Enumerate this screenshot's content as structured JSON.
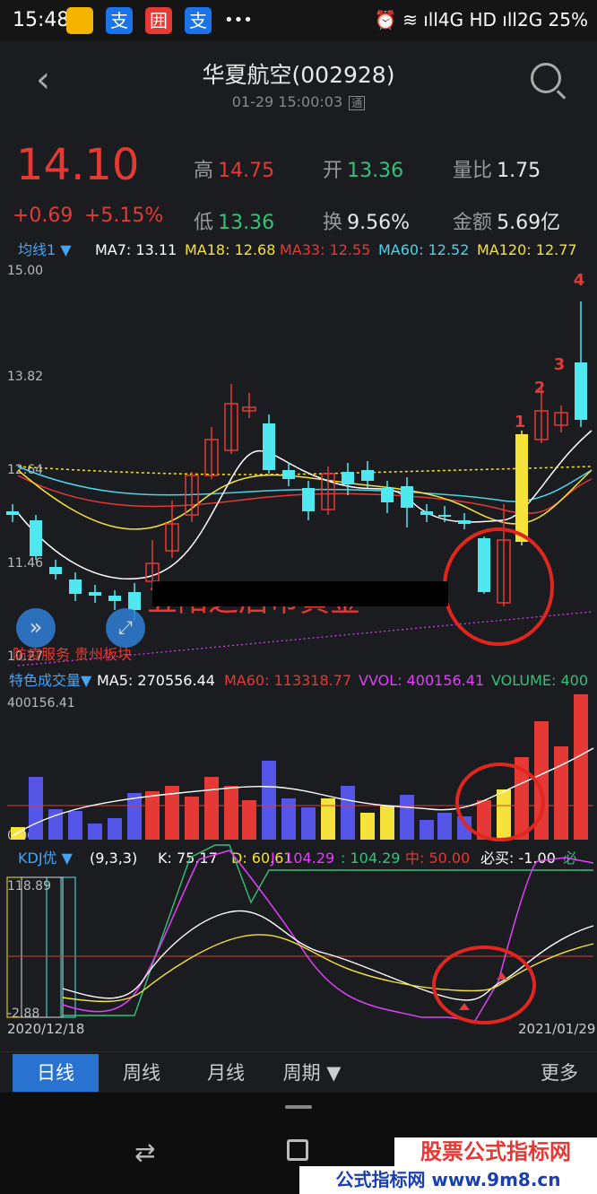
{
  "status": {
    "time": "15:48",
    "apps": [
      "支",
      "囲",
      "支"
    ],
    "more": "•••",
    "right": "⏰ ≋ ıll4G HD ıll2G 25%"
  },
  "header": {
    "title": "华夏航空(002928)",
    "datetime": "01-29 15:00:03",
    "badge": "通"
  },
  "quote": {
    "price": "14.10",
    "change": "+0.69",
    "change_pct": "+5.15%",
    "stats": [
      {
        "label": "高",
        "value": "14.75",
        "color": "red"
      },
      {
        "label": "开",
        "value": "13.36",
        "color": "green"
      },
      {
        "label": "量比",
        "value": "1.75",
        "color": "white"
      },
      {
        "label": "低",
        "value": "13.36",
        "color": "green"
      },
      {
        "label": "换",
        "value": "9.56%",
        "color": "white"
      },
      {
        "label": "金额",
        "value": "5.69亿",
        "color": "white"
      }
    ]
  },
  "ma_legend": [
    {
      "text": "均线1 ▼",
      "color": "#4aa3f0"
    },
    {
      "text": "MA7: 13.11",
      "color": "#ffffff"
    },
    {
      "text": "MA18: 12.68",
      "color": "#f5e23a"
    },
    {
      "text": "MA33: 12.55",
      "color": "#e53935"
    },
    {
      "text": "MA60: 12.52",
      "color": "#4fd3e8"
    },
    {
      "text": "MA120: 12.77",
      "color": "#f5e23a"
    }
  ],
  "price_axis": [
    "15.00",
    "13.82",
    "12.64",
    "11.46",
    "10.27"
  ],
  "wave_labels": [
    "1",
    "2",
    "3",
    "4"
  ],
  "overlay_text": "五阳之后市黄金",
  "overlay_bottom": "防疫服务 贵州板块",
  "vol_legend": [
    {
      "text": "特色成交量▼",
      "color": "#4aa3f0"
    },
    {
      "text": "MA5: 270556.44",
      "color": "#ffffff"
    },
    {
      "text": "MA60: 113318.77",
      "color": "#e53935"
    },
    {
      "text": "VVOL: 400156.41",
      "color": "#e040fb"
    },
    {
      "text": "VOLUME: 400",
      "color": "#33c27a"
    }
  ],
  "vol_axis": [
    "400156.41",
    "0.00"
  ],
  "kdj_legend": [
    {
      "text": "KDJ优 ▼",
      "color": "#4aa3f0"
    },
    {
      "text": "(9,3,3)",
      "color": "#ffffff"
    },
    {
      "text": "K: 75.17",
      "color": "#ffffff"
    },
    {
      "text": "D: 60.61",
      "color": "#f5e23a"
    },
    {
      "text": "J: 104.29",
      "color": "#e040fb"
    },
    {
      "text": ": 104.29",
      "color": "#33c27a"
    },
    {
      "text": "中: 50.00",
      "color": "#e53935"
    },
    {
      "text": "必买: -1.00",
      "color": "#ffffff"
    },
    {
      "text": "必",
      "color": "#33c27a"
    }
  ],
  "kdj_axis": [
    "118.89",
    "-2.88"
  ],
  "dates": {
    "start": "2020/12/18",
    "end": "2021/01/29"
  },
  "tabs": [
    "日线",
    "周线",
    "月线",
    "周期 ▼",
    "更多"
  ],
  "watermark": {
    "line1": "股票公式指标网",
    "line2": "公式指标网 www.9m8.cn"
  },
  "colors": {
    "up": "#e53935",
    "down": "#33c27a",
    "accent": "#2872d0"
  }
}
